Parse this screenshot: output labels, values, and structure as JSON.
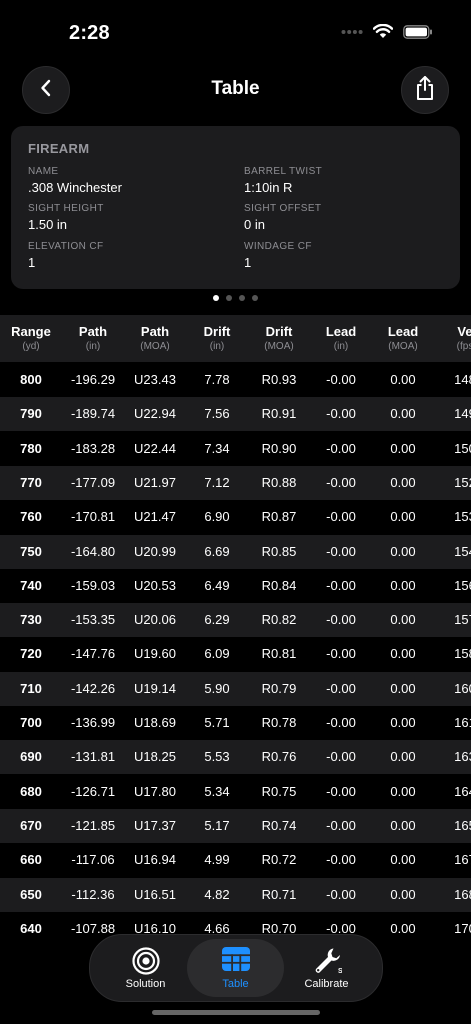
{
  "status": {
    "time": "2:28"
  },
  "nav": {
    "title": "Table"
  },
  "firearm": {
    "title": "FIREARM",
    "fields": [
      {
        "label": "NAME",
        "value": ".308 Winchester"
      },
      {
        "label": "BARREL TWIST",
        "value": "1:10in R"
      },
      {
        "label": "SIGHT HEIGHT",
        "value": "1.50 in"
      },
      {
        "label": "SIGHT OFFSET",
        "value": "0 in"
      },
      {
        "label": "ELEVATION CF",
        "value": "1"
      },
      {
        "label": "WINDAGE CF",
        "value": "1"
      }
    ]
  },
  "pager": {
    "count": 4,
    "active": 0
  },
  "table": {
    "columns": [
      {
        "name": "Range",
        "unit": "(yd)"
      },
      {
        "name": "Path",
        "unit": "(in)"
      },
      {
        "name": "Path",
        "unit": "(MOA)"
      },
      {
        "name": "Drift",
        "unit": "(in)"
      },
      {
        "name": "Drift",
        "unit": "(MOA)"
      },
      {
        "name": "Lead",
        "unit": "(in)"
      },
      {
        "name": "Lead",
        "unit": "(MOA)"
      },
      {
        "name": "Ve",
        "unit": "(fps"
      }
    ],
    "rows": [
      [
        "800",
        "-196.29",
        "U23.43",
        "7.78",
        "R0.93",
        "-0.00",
        "0.00",
        "148"
      ],
      [
        "790",
        "-189.74",
        "U22.94",
        "7.56",
        "R0.91",
        "-0.00",
        "0.00",
        "149"
      ],
      [
        "780",
        "-183.28",
        "U22.44",
        "7.34",
        "R0.90",
        "-0.00",
        "0.00",
        "150"
      ],
      [
        "770",
        "-177.09",
        "U21.97",
        "7.12",
        "R0.88",
        "-0.00",
        "0.00",
        "152"
      ],
      [
        "760",
        "-170.81",
        "U21.47",
        "6.90",
        "R0.87",
        "-0.00",
        "0.00",
        "153"
      ],
      [
        "750",
        "-164.80",
        "U20.99",
        "6.69",
        "R0.85",
        "-0.00",
        "0.00",
        "154"
      ],
      [
        "740",
        "-159.03",
        "U20.53",
        "6.49",
        "R0.84",
        "-0.00",
        "0.00",
        "156"
      ],
      [
        "730",
        "-153.35",
        "U20.06",
        "6.29",
        "R0.82",
        "-0.00",
        "0.00",
        "157"
      ],
      [
        "720",
        "-147.76",
        "U19.60",
        "6.09",
        "R0.81",
        "-0.00",
        "0.00",
        "158"
      ],
      [
        "710",
        "-142.26",
        "U19.14",
        "5.90",
        "R0.79",
        "-0.00",
        "0.00",
        "160"
      ],
      [
        "700",
        "-136.99",
        "U18.69",
        "5.71",
        "R0.78",
        "-0.00",
        "0.00",
        "161"
      ],
      [
        "690",
        "-131.81",
        "U18.25",
        "5.53",
        "R0.76",
        "-0.00",
        "0.00",
        "163"
      ],
      [
        "680",
        "-126.71",
        "U17.80",
        "5.34",
        "R0.75",
        "-0.00",
        "0.00",
        "164"
      ],
      [
        "670",
        "-121.85",
        "U17.37",
        "5.17",
        "R0.74",
        "-0.00",
        "0.00",
        "165"
      ],
      [
        "660",
        "-117.06",
        "U16.94",
        "4.99",
        "R0.72",
        "-0.00",
        "0.00",
        "167"
      ],
      [
        "650",
        "-112.36",
        "U16.51",
        "4.82",
        "R0.71",
        "-0.00",
        "0.00",
        "168"
      ],
      [
        "640",
        "-107.88",
        "U16.10",
        "4.66",
        "R0.70",
        "-0.00",
        "0.00",
        "170"
      ]
    ]
  },
  "tabs": [
    {
      "label": "Solution",
      "icon": "target-icon",
      "active": false
    },
    {
      "label": "Table",
      "icon": "table-icon",
      "active": true
    },
    {
      "label": "Calibrate",
      "icon": "wrench-icon",
      "active": false
    }
  ],
  "colors": {
    "accent": "#1e90ff",
    "card": "#1c1c1e",
    "background": "#000000"
  }
}
